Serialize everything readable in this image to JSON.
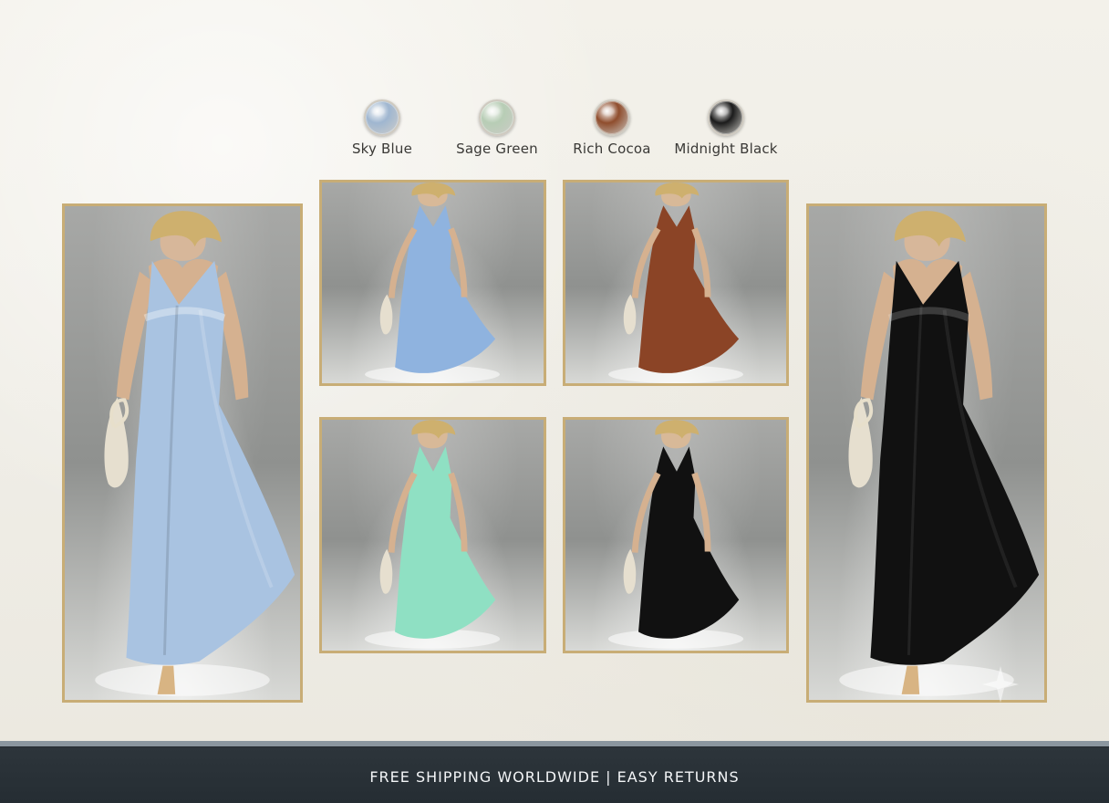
{
  "swatches": [
    {
      "label": "Sky Blue",
      "color": "#9fb6d0"
    },
    {
      "label": "Sage Green",
      "color": "#b7cdb5"
    },
    {
      "label": "Rich Cocoa",
      "color": "#8f4d2d"
    },
    {
      "label": "Midnight Black",
      "color": "#1b1b1b"
    }
  ],
  "gallery": [
    {
      "dress_color": "#a9c3e1",
      "alt_color": "Sky Blue"
    },
    {
      "dress_color": "#8fb3df",
      "alt_color": "Sky Blue"
    },
    {
      "dress_color": "#8b4426",
      "alt_color": "Rich Cocoa"
    },
    {
      "dress_color": "#111111",
      "alt_color": "Midnight Black"
    },
    {
      "dress_color": "#8fe0c3",
      "alt_color": "Sage Green"
    },
    {
      "dress_color": "#111111",
      "alt_color": "Midnight Black"
    }
  ],
  "footer": {
    "text": "FREE SHIPPING WORLDWIDE | EASY RETURNS"
  }
}
